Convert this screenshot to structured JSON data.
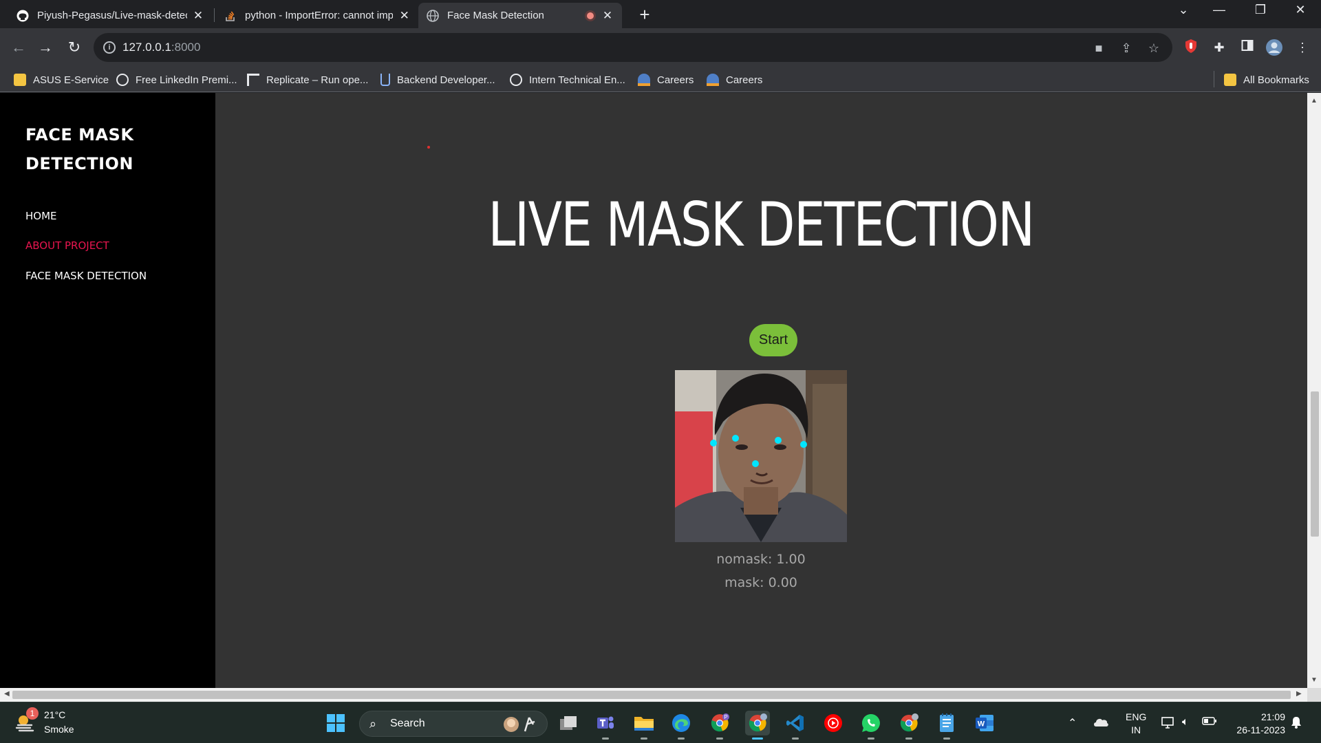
{
  "browser": {
    "tabs": [
      {
        "title": "Piyush-Pegasus/Live-mask-detection",
        "icon": "github-icon"
      },
      {
        "title": "python - ImportError: cannot import",
        "icon": "stackoverflow-icon"
      },
      {
        "title": "Face Mask Detection",
        "icon": "globe-icon",
        "active": true,
        "recording": true
      }
    ],
    "url_host": "127.0.0.1",
    "url_port": ":8000",
    "bookmarks": [
      {
        "label": "ASUS E-Service",
        "icon": "folder-icon"
      },
      {
        "label": "Free LinkedIn Premi...",
        "icon": "globe-icon"
      },
      {
        "label": "Replicate – Run ope...",
        "icon": "replicate-icon"
      },
      {
        "label": "Backend Developer...",
        "icon": "bookmark-icon"
      },
      {
        "label": "Intern Technical En...",
        "icon": "globe-icon"
      },
      {
        "label": "Careers",
        "icon": "careers-icon"
      },
      {
        "label": "Careers",
        "icon": "careers-icon"
      }
    ],
    "all_bookmarks": "All Bookmarks"
  },
  "page": {
    "brand": "FACE MASK DETECTION",
    "nav": [
      {
        "label": "HOME",
        "active": false
      },
      {
        "label": "ABOUT PROJECT",
        "active": true
      },
      {
        "label": "FACE MASK DETECTION",
        "active": false
      }
    ],
    "title": "LIVE MASK DETECTION",
    "start_button": "Start",
    "results": {
      "nomask": "nomask: 1.00",
      "mask": "mask: 0.00"
    }
  },
  "taskbar": {
    "weather_temp": "21°C",
    "weather_desc": "Smoke",
    "weather_badge": "1",
    "search_label": "Search",
    "lang_line1": "ENG",
    "lang_line2": "IN",
    "time": "21:09",
    "date": "26-11-2023"
  },
  "colors": {
    "sidebar_bg": "#000000",
    "content_bg": "#333333",
    "nav_active": "#e8154f",
    "start_button": "#7bbf3a",
    "landmark": "#00e5ff"
  }
}
